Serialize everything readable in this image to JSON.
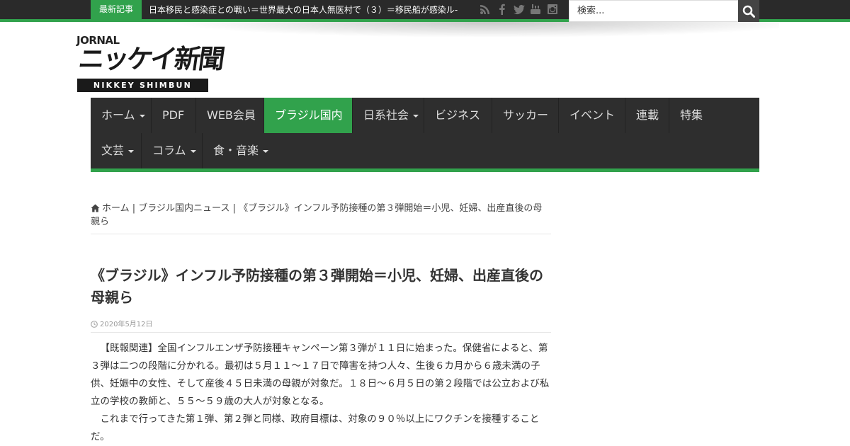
{
  "topbar": {
    "breaking_label": "最新記事",
    "breaking_text": "日本移民と感染症との戦い＝世界最大の日本人無医村で（３）＝移民船が感染ル-",
    "social_icons": [
      "rss-icon",
      "facebook-icon",
      "twitter-icon",
      "youtube-icon",
      "instagram-icon"
    ],
    "search_placeholder": "検索..."
  },
  "logo": {
    "top_text": "JORNAL",
    "main_text": "ニッケイ新聞",
    "sub_text": "NIKKEY SHIMBUN"
  },
  "nav": {
    "row1": [
      {
        "label": "ホーム",
        "dropdown": true
      },
      {
        "label": "PDF",
        "dropdown": false
      },
      {
        "label": "WEB会員",
        "dropdown": false
      },
      {
        "label": "ブラジル国内",
        "dropdown": false,
        "active": true
      },
      {
        "label": "日系社会",
        "dropdown": true
      },
      {
        "label": "ビジネス",
        "dropdown": false
      },
      {
        "label": "サッカー",
        "dropdown": false
      },
      {
        "label": "イベント",
        "dropdown": false
      },
      {
        "label": "連載",
        "dropdown": false
      },
      {
        "label": "特集",
        "dropdown": false
      }
    ],
    "row2": [
      {
        "label": "文芸",
        "dropdown": true
      },
      {
        "label": "コラム",
        "dropdown": true
      },
      {
        "label": "食・音楽",
        "dropdown": true
      }
    ]
  },
  "breadcrumb": {
    "home": "ホーム",
    "sep": "|",
    "category": "ブラジル国内ニュース",
    "current": "《ブラジル》インフル予防接種の第３弾開始＝小児、妊婦、出産直後の母親ら"
  },
  "article": {
    "title": "《ブラジル》インフル予防接種の第３弾開始＝小児、妊婦、出産直後の母親ら",
    "date": "2020年5月12日",
    "paragraphs": [
      "【既報関連】全国インフルエンザ予防接種キャンペーン第３弾が１１日に始まった。保健省によると、第３弾は二つの段階に分かれる。最初は５月１１～１７日で障害を持つ人々、生後６カ月から６歳未満の子供、妊娠中の女性、そして産後４５日未満の母親が対象だ。１８日～６月５日の第２段階では公立および私立の学校の教師と、５５〜５９歳の大人が対象となる。",
      "これまで行ってきた第１弾、第２弾と同様、政府目標は、対象の９０％以上にワクチンを接種することだ。"
    ]
  },
  "colors": {
    "accent": "#31a24c",
    "topbar_bg": "#2a2a2a",
    "nav_bg": "#2e2e2e"
  }
}
